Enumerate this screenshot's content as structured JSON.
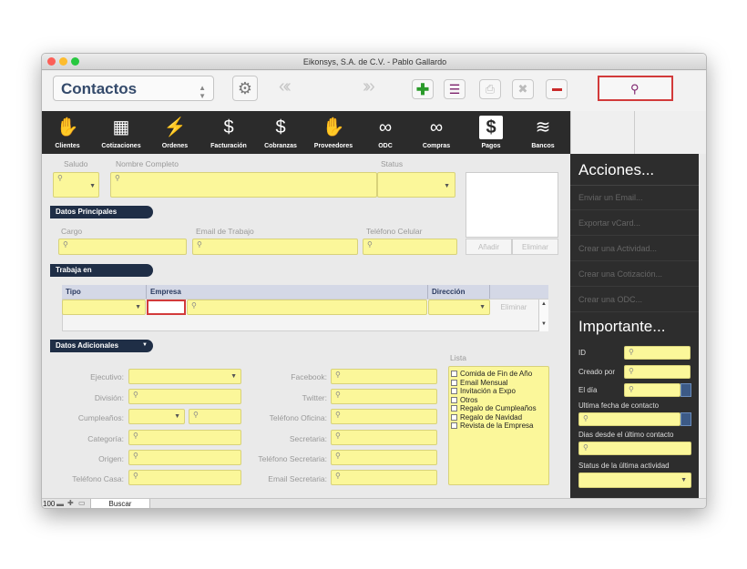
{
  "window": {
    "title": "Eikonsys, S.A. de C.V. - Pablo Gallardo"
  },
  "toolbar": {
    "module": "Contactos",
    "buttons": [
      {
        "name": "settings-button",
        "icon": "gear-icon"
      },
      {
        "name": "new-record-button",
        "icon": "plus-icon",
        "color": "#2a9a2a"
      },
      {
        "name": "list-view-button",
        "icon": "list-icon",
        "color": "#7a1d6a"
      },
      {
        "name": "print-button",
        "icon": "printer-icon"
      },
      {
        "name": "close-record-button",
        "icon": "x-icon"
      },
      {
        "name": "delete-record-button",
        "icon": "minus-icon",
        "color": "#c92a2a"
      },
      {
        "name": "search-button",
        "icon": "search-icon",
        "color": "#7a1d6a"
      }
    ]
  },
  "modules": [
    {
      "label": "Clientes",
      "icon": "handshake-icon"
    },
    {
      "label": "Cotizaciones",
      "icon": "calculator-icon"
    },
    {
      "label": "Ordenes",
      "icon": "lightning-icon"
    },
    {
      "label": "Facturación",
      "icon": "invoice-icon"
    },
    {
      "label": "Cobranzas",
      "icon": "money-icon"
    },
    {
      "label": "Proveedores",
      "icon": "handshake-icon"
    },
    {
      "label": "ODC",
      "icon": "rings-icon"
    },
    {
      "label": "Compras",
      "icon": "rings-icon"
    },
    {
      "label": "Pagos",
      "icon": "dollar-icon"
    },
    {
      "label": "Bancos",
      "icon": "stack-icon"
    }
  ],
  "header_fields": {
    "saludo": "Saludo",
    "nombre": "Nombre Completo",
    "status": "Status"
  },
  "photo": {
    "add": "Añadir",
    "remove": "Eliminar"
  },
  "datos_principales": {
    "title": "Datos Principales",
    "cargo": "Cargo",
    "email": "Email de Trabajo",
    "telefono": "Teléfono Celular"
  },
  "trabaja_en": {
    "title": "Trabaja en",
    "columns": [
      "Tipo",
      "Empresa",
      "Dirección"
    ],
    "remove": "Eliminar"
  },
  "datos_adicionales": {
    "title": "Datos Adicionales",
    "left_labels": [
      "Ejecutivo:",
      "División:",
      "Cumpleaños:",
      "Categoría:",
      "Origen:",
      "Teléfono Casa:"
    ],
    "mid_labels": [
      "Facebook:",
      "Twitter:",
      "Teléfono Oficina:",
      "Secretaria:",
      "Teléfono Secretaria:",
      "Email Secretaria:"
    ],
    "lista_label": "Lista",
    "lista": [
      "Comida de Fin de Año",
      "Email Mensual",
      "Invitación a Expo",
      "Otros",
      "Regalo de Cumpleaños",
      "Regalo de Navidad",
      "Revista de la Empresa"
    ]
  },
  "acciones": {
    "title": "Acciones...",
    "items": [
      "Enviar un Email...",
      "Exportar vCard...",
      "Crear una Actividad...",
      "Crear una Cotización...",
      "Crear una ODC..."
    ]
  },
  "importante": {
    "title": "Importante...",
    "id": "ID",
    "creado_por": "Creado por",
    "el_dia": "El día",
    "ultima_fecha": "Ultima fecha de contacto",
    "dias_desde": "Dias desde el último contacto",
    "status_actividad": "Status de la última actividad"
  },
  "statusbar": {
    "zoom": "100",
    "mode": "Buscar"
  }
}
